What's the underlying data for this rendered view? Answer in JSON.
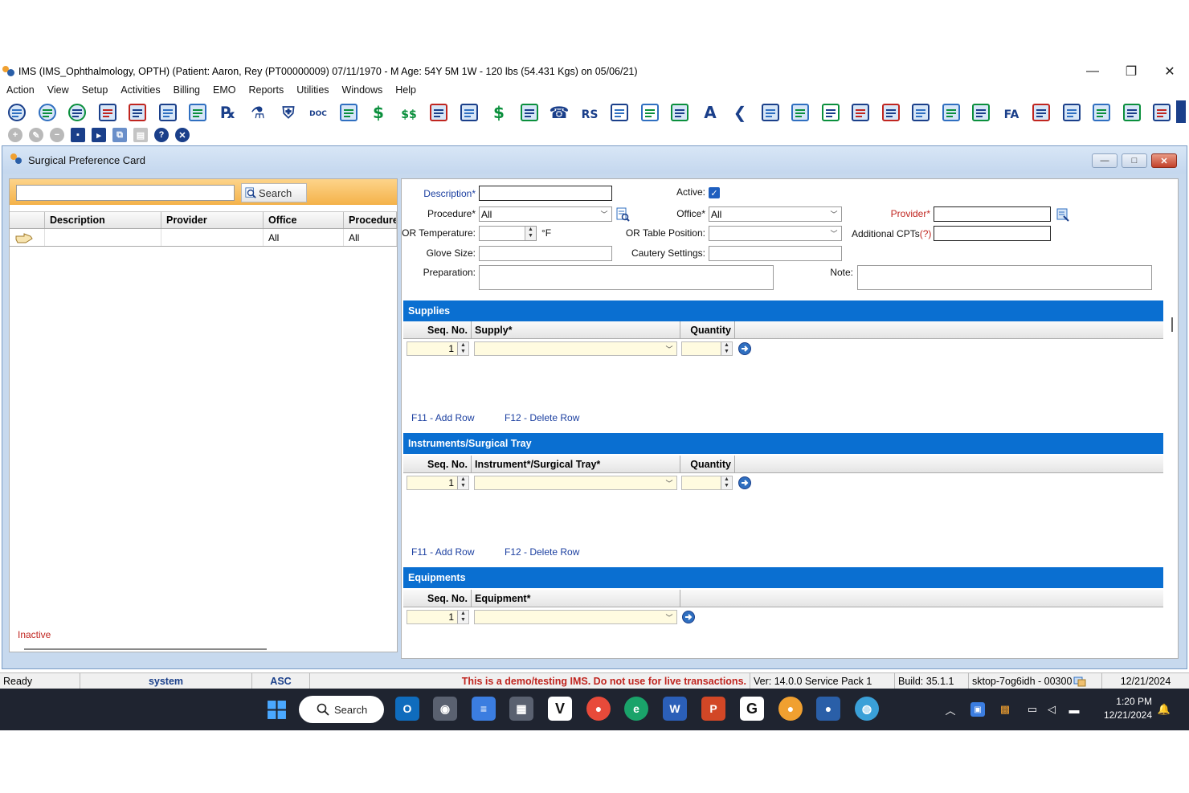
{
  "window": {
    "title": "IMS (IMS_Ophthalmology, OPTH)    (Patient: Aaron, Rey  (PT00000009) 07/11/1970 - M Age: 54Y 5M 1W - 120 lbs (54.431 Kgs) on 05/06/21)",
    "minimize": "—",
    "restore": "❐",
    "close": "✕"
  },
  "menu": [
    "Action",
    "View",
    "Setup",
    "Activities",
    "Billing",
    "EMO",
    "Reports",
    "Utilities",
    "Windows",
    "Help"
  ],
  "toolbar_icons": [
    "patient-icon",
    "patient-check-icon",
    "patient-verify-icon",
    "document-edit-icon",
    "document-dollar-icon",
    "chart-list-icon",
    "pharmacy-icon",
    "rx-icon",
    "lab-flask-icon",
    "shield-icon",
    "doc-icon",
    "note-pad-icon",
    "dollar-icon",
    "dollar-double-icon",
    "dollar-user-icon",
    "dollar-refresh-icon",
    "dollar-small-icon",
    "dollar-people-icon",
    "phone-call-icon",
    "rs-calendar-icon",
    "calendar-icon",
    "calendar-grid-icon",
    "transfer-icon",
    "font-check-icon",
    "back-arrow-icon",
    "tray-down-icon",
    "tray-up-icon",
    "calendar-clock-icon",
    "clipboard-check-icon",
    "chart-pie-icon",
    "id-card-icon",
    "clipboard-stack-icon",
    "phone-book-icon",
    "fax-icon",
    "handshake-icon",
    "bar-chart-icon",
    "key-dollar-icon",
    "dollar-clock-icon",
    "notebook-icon"
  ],
  "toolbar2_icons": [
    "add-icon",
    "edit-icon",
    "remove-icon",
    "save-icon",
    "folder-icon",
    "copy-icon",
    "print-icon",
    "help-icon",
    "cancel-icon"
  ],
  "mdi": {
    "title": "Surgical Preference Card",
    "min": "—",
    "max": "□",
    "close": "✕"
  },
  "left": {
    "search_label": "Search",
    "columns": [
      "Description",
      "Provider",
      "Office",
      "Procedure"
    ],
    "row": {
      "description": "",
      "provider": "",
      "office": "All",
      "procedure": "All"
    },
    "inactive_label": "Inactive"
  },
  "form": {
    "description_label": "Description*",
    "description_value": "",
    "active_label": "Active:",
    "active_checked": "✓",
    "procedure_label": "Procedure*",
    "procedure_value": "All",
    "office_label": "Office*",
    "office_value": "All",
    "provider_label": "Provider*",
    "provider_value": "",
    "or_temp_label": "OR Temperature:",
    "or_temp_unit": "°F",
    "or_table_label": "OR Table Position:",
    "additional_cpts_label": "Additional CPTs",
    "additional_cpts_help": "(?)",
    "glove_label": "Glove Size:",
    "cautery_label": "Cautery Settings:",
    "preparation_label": "Preparation:",
    "note_label": "Note:"
  },
  "supplies": {
    "title": "Supplies",
    "col_seq": "Seq. No.",
    "col_item": "Supply*",
    "col_qty": "Quantity",
    "seq_value": "1",
    "add_row": "F11 - Add Row",
    "delete_row": "F12 - Delete Row"
  },
  "instruments": {
    "title": "Instruments/Surgical Tray",
    "col_seq": "Seq. No.",
    "col_item": "Instrument*/Surgical Tray*",
    "col_qty": "Quantity",
    "seq_value": "1",
    "add_row": "F11 - Add Row",
    "delete_row": "F12 - Delete Row"
  },
  "equipments": {
    "title": "Equipments",
    "col_seq": "Seq. No.",
    "col_item": "Equipment*",
    "seq_value": "1"
  },
  "status": {
    "ready": "Ready",
    "user": "system",
    "mode": "ASC",
    "warning": "This is a demo/testing IMS. Do not use for live transactions.",
    "version": "Ver: 14.0.0 Service Pack 1",
    "build": "Build: 35.1.1",
    "machine": "sktop-7og6idh - 00300",
    "date": "12/21/2024"
  },
  "taskbar": {
    "search_label": "Search",
    "time": "1:20 PM",
    "date": "12/21/2024"
  },
  "colors": {
    "section_blue": "#0a6fd1",
    "toolbar_blue": "#1a3f8a",
    "warning_red": "#c0251f",
    "label_blue": "#1b3fa0"
  }
}
